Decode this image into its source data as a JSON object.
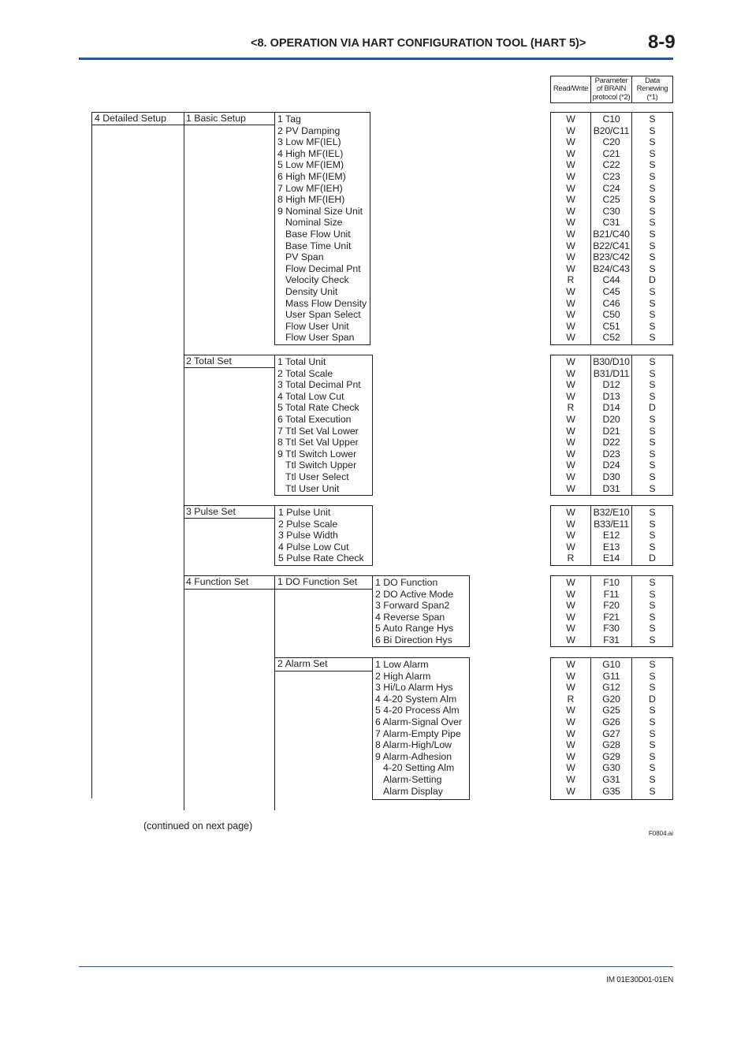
{
  "header": {
    "section_title": "<8.  OPERATION VIA HART CONFIGURATION TOOL (HART 5)>",
    "page_number": "8-9",
    "rule_color": "#2255a8"
  },
  "table_header": {
    "read_write": "Read/Write",
    "parameter": "Parameter of BRAIN protocol (*2)",
    "data_renewing": "Data Renewing (*1)"
  },
  "menu": {
    "level1": "4 Detailed Setup",
    "groups": [
      {
        "label": "1 Basic Setup",
        "items": [
          {
            "text": "1 Tag",
            "indent": false
          },
          {
            "text": "2 PV Damping",
            "indent": false
          },
          {
            "text": "3 Low MF(IEL)",
            "indent": false
          },
          {
            "text": "4 High MF(IEL)",
            "indent": false
          },
          {
            "text": "5 Low MF(IEM)",
            "indent": false
          },
          {
            "text": "6 High MF(IEM)",
            "indent": false
          },
          {
            "text": "7 Low MF(IEH)",
            "indent": false
          },
          {
            "text": "8 High MF(IEH)",
            "indent": false
          },
          {
            "text": "9 Nominal Size Unit",
            "indent": false
          },
          {
            "text": "Nominal Size",
            "indent": true
          },
          {
            "text": "Base Flow Unit",
            "indent": true
          },
          {
            "text": "Base Time Unit",
            "indent": true
          },
          {
            "text": "PV Span",
            "indent": true
          },
          {
            "text": "Flow Decimal Pnt",
            "indent": true
          },
          {
            "text": "Velocity Check",
            "indent": true
          },
          {
            "text": "Density Unit",
            "indent": true
          },
          {
            "text": "Mass Flow Density",
            "indent": true
          },
          {
            "text": "User Span Select",
            "indent": true
          },
          {
            "text": "Flow User Unit",
            "indent": true
          },
          {
            "text": "Flow User Span",
            "indent": true
          }
        ],
        "rw": [
          "W",
          "W",
          "W",
          "W",
          "W",
          "W",
          "W",
          "W",
          "W",
          "W",
          "W",
          "W",
          "W",
          "W",
          "R",
          "W",
          "W",
          "W",
          "W",
          "W"
        ],
        "param": [
          "C10",
          "B20/C11",
          "C20",
          "C21",
          "C22",
          "C23",
          "C24",
          "C25",
          "C30",
          "C31",
          "B21/C40",
          "B22/C41",
          "B23/C42",
          "B24/C43",
          "C44",
          "C45",
          "C46",
          "C50",
          "C51",
          "C52"
        ],
        "renew": [
          "S",
          "S",
          "S",
          "S",
          "S",
          "S",
          "S",
          "S",
          "S",
          "S",
          "S",
          "S",
          "S",
          "S",
          "D",
          "S",
          "S",
          "S",
          "S",
          "S"
        ]
      },
      {
        "label": "2 Total Set",
        "items": [
          {
            "text": "1 Total Unit",
            "indent": false
          },
          {
            "text": "2 Total Scale",
            "indent": false
          },
          {
            "text": "3 Total Decimal Pnt",
            "indent": false
          },
          {
            "text": "4 Total Low Cut",
            "indent": false
          },
          {
            "text": "5 Total Rate Check",
            "indent": false
          },
          {
            "text": "6 Total Execution",
            "indent": false
          },
          {
            "text": "7 Ttl Set Val Lower",
            "indent": false
          },
          {
            "text": "8 Ttl Set Val Upper",
            "indent": false
          },
          {
            "text": "9 Ttl Switch Lower",
            "indent": false
          },
          {
            "text": "Ttl Switch Upper",
            "indent": true
          },
          {
            "text": "Ttl User Select",
            "indent": true
          },
          {
            "text": "Ttl User Unit",
            "indent": true
          }
        ],
        "rw": [
          "W",
          "W",
          "W",
          "W",
          "R",
          "W",
          "W",
          "W",
          "W",
          "W",
          "W",
          "W"
        ],
        "param": [
          "B30/D10",
          "B31/D11",
          "D12",
          "D13",
          "D14",
          "D20",
          "D21",
          "D22",
          "D23",
          "D24",
          "D30",
          "D31"
        ],
        "renew": [
          "S",
          "S",
          "S",
          "S",
          "D",
          "S",
          "S",
          "S",
          "S",
          "S",
          "S",
          "S"
        ]
      },
      {
        "label": "3 Pulse Set",
        "items": [
          {
            "text": "1 Pulse Unit",
            "indent": false
          },
          {
            "text": "2 Pulse Scale",
            "indent": false
          },
          {
            "text": "3 Pulse Width",
            "indent": false
          },
          {
            "text": "4 Pulse Low Cut",
            "indent": false
          },
          {
            "text": "5 Pulse Rate Check",
            "indent": false
          }
        ],
        "rw": [
          "W",
          "W",
          "W",
          "W",
          "R"
        ],
        "param": [
          "B32/E10",
          "B33/E11",
          "E12",
          "E13",
          "E14"
        ],
        "renew": [
          "S",
          "S",
          "S",
          "S",
          "D"
        ]
      },
      {
        "label": "4 Function Set",
        "subgroups": [
          {
            "label": "1 DO Function Set",
            "items": [
              {
                "text": "1 DO Function",
                "indent": false
              },
              {
                "text": "2 DO Active Mode",
                "indent": false
              },
              {
                "text": "3 Forward Span2",
                "indent": false
              },
              {
                "text": "4 Reverse Span",
                "indent": false
              },
              {
                "text": "5 Auto Range Hys",
                "indent": false
              },
              {
                "text": "6 Bi Direction Hys",
                "indent": false
              }
            ],
            "rw": [
              "W",
              "W",
              "W",
              "W",
              "W",
              "W"
            ],
            "param": [
              "F10",
              "F11",
              "F20",
              "F21",
              "F30",
              "F31"
            ],
            "renew": [
              "S",
              "S",
              "S",
              "S",
              "S",
              "S"
            ]
          },
          {
            "label": "2 Alarm Set",
            "items": [
              {
                "text": "1 Low Alarm",
                "indent": false
              },
              {
                "text": "2 High Alarm",
                "indent": false
              },
              {
                "text": "3 Hi/Lo Alarm Hys",
                "indent": false
              },
              {
                "text": "4 4-20 System Alm",
                "indent": false
              },
              {
                "text": "5 4-20 Process Alm",
                "indent": false
              },
              {
                "text": "6 Alarm-Signal Over",
                "indent": false
              },
              {
                "text": "7 Alarm-Empty Pipe",
                "indent": false
              },
              {
                "text": "8 Alarm-High/Low",
                "indent": false
              },
              {
                "text": "9 Alarm-Adhesion",
                "indent": false
              },
              {
                "text": "4-20 Setting Alm",
                "indent": true
              },
              {
                "text": "Alarm-Setting",
                "indent": true
              },
              {
                "text": "Alarm Display",
                "indent": true
              }
            ],
            "rw": [
              "W",
              "W",
              "W",
              "R",
              "W",
              "W",
              "W",
              "W",
              "W",
              "W",
              "W",
              "W"
            ],
            "param": [
              "G10",
              "G11",
              "G12",
              "G20",
              "G25",
              "G26",
              "G27",
              "G28",
              "G29",
              "G30",
              "G31",
              "G35"
            ],
            "renew": [
              "S",
              "S",
              "S",
              "D",
              "S",
              "S",
              "S",
              "S",
              "S",
              "S",
              "S",
              "S"
            ]
          }
        ]
      }
    ]
  },
  "footnote": {
    "continued": "(continued on next page)",
    "figure_id": "F0804.ai"
  },
  "footer": {
    "doc_number": "IM 01E30D01-01EN"
  }
}
